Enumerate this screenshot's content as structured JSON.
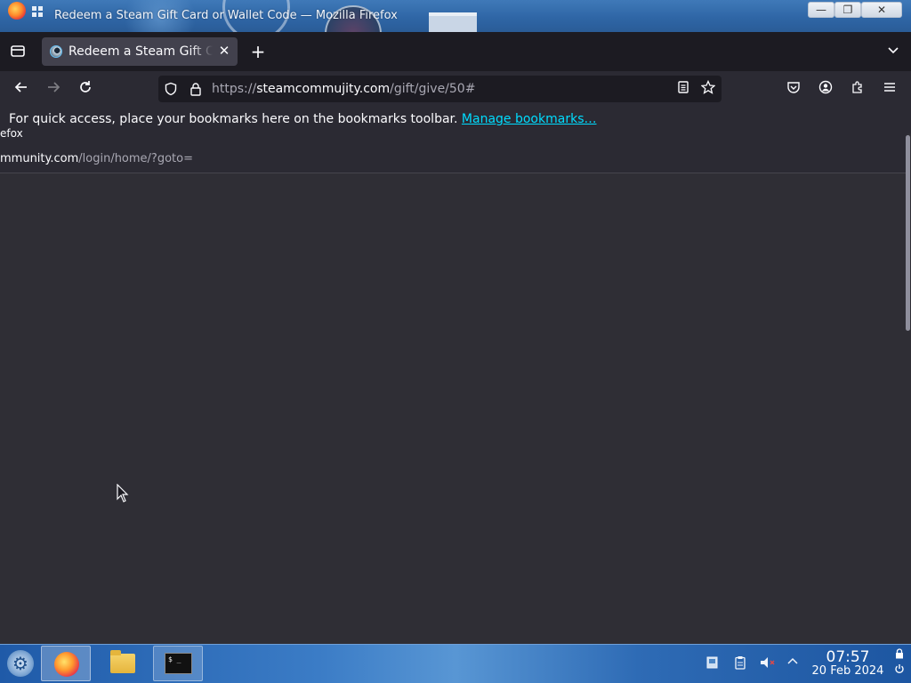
{
  "window": {
    "title": "Redeem a Steam Gift Card or Wallet Code — Mozilla Firefox",
    "buttons": {
      "minimize": "—",
      "maximize": "❐",
      "close": "✕"
    }
  },
  "tabs": [
    {
      "title": "Redeem a Steam Gift Card or Wallet Code",
      "favicon": "steam-icon",
      "active": true
    }
  ],
  "newtab_label": "+",
  "navigation": {
    "url_scheme": "https://",
    "url_host": "steamcommujity.com",
    "url_path": "/gift/give/50#"
  },
  "bookmarks_bar": {
    "message": "For quick access, place your bookmarks here on the bookmarks toolbar.",
    "link_label": "Manage bookmarks…"
  },
  "content": {
    "fragment_title": "efox",
    "fragment_url_host": "mmunity.com",
    "fragment_url_path": "/login/home/?goto="
  },
  "taskbar": {
    "apps": [
      {
        "name": "Firefox",
        "icon": "firefox-icon",
        "active": true
      },
      {
        "name": "Files",
        "icon": "folder-icon",
        "active": false
      },
      {
        "name": "Terminal",
        "icon": "terminal-icon",
        "active": false
      }
    ],
    "terminal_glyph": "$ _",
    "clock": {
      "time": "07:57",
      "date": "20 Feb 2024"
    }
  },
  "colors": {
    "accent_link": "#00ddff",
    "browser_bg": "#2b2a33",
    "taskbar": "#2e6bb5"
  }
}
